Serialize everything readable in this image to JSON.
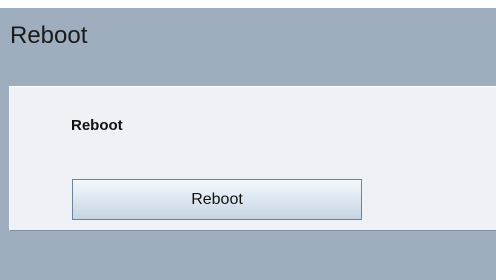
{
  "header": {
    "title": "Reboot"
  },
  "panel": {
    "heading": "Reboot",
    "button_label": "Reboot"
  },
  "colors": {
    "page_background": "#9eaebf",
    "panel_background": "#eef1f5",
    "button_border": "#6d8399"
  }
}
